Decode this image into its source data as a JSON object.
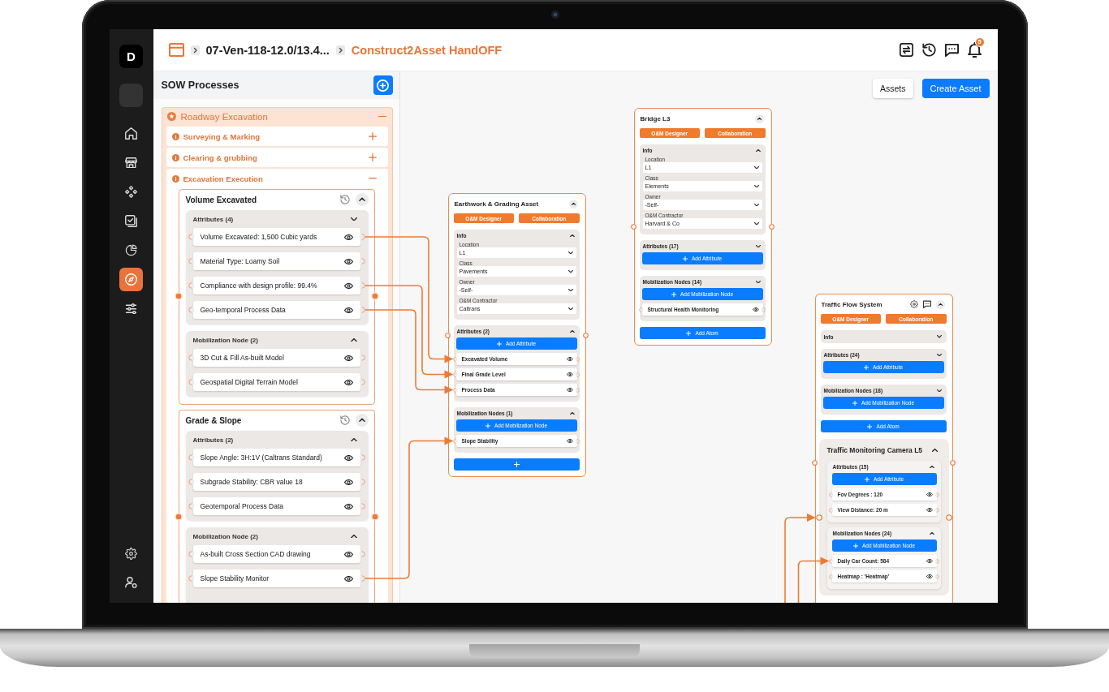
{
  "sidebar": {
    "logo": "D",
    "items": [
      {
        "selected": false
      },
      {
        "selected": false
      },
      {
        "selected": false
      },
      {
        "selected": false
      },
      {
        "selected": false
      },
      {
        "selected": true
      },
      {
        "selected": false
      }
    ],
    "footer_items": [
      {
        "selected": false
      },
      {
        "selected": false
      }
    ]
  },
  "top_bar": {
    "breadcrumb": [
      {
        "label": "07-Ven-118-12.0/13.4...",
        "current": false
      },
      {
        "label": "Construct2Asset HandOFF",
        "current": true
      }
    ],
    "notifications": "5"
  },
  "sow_panel": {
    "title": "SOW Processes",
    "processes": [
      {
        "label": "Roadway Excavation",
        "expanded": true,
        "steps": [
          {
            "label": "Surveying & Marking",
            "expanded": false
          },
          {
            "label": "Clearing & grubbing",
            "expanded": false
          },
          {
            "label": "Excavation Execution",
            "expanded": true,
            "cards": [
              {
                "title": "Volume Excavated",
                "expanded": true,
                "sections": [
                  {
                    "title": "Attributes (4)",
                    "expanded": false,
                    "items": [
                      {
                        "label": "Volume Excavated: 1,500 Cubic yards",
                        "connected": true
                      },
                      {
                        "label": "Material Type: Loamy Soil",
                        "connected": false
                      },
                      {
                        "label": "Compliance with design profile: 99.4%",
                        "connected": true
                      },
                      {
                        "label": "Geo-temporal Process Data",
                        "connected": true
                      }
                    ]
                  },
                  {
                    "title": "Mobilization Node (2)",
                    "expanded": true,
                    "items": [
                      {
                        "label": "3D Cut & Fill As-built Model",
                        "connected": false
                      },
                      {
                        "label": "Geospatial Digital Terrain Model",
                        "connected": false
                      }
                    ]
                  }
                ]
              },
              {
                "title": "Grade & Slope",
                "expanded": true,
                "sections": [
                  {
                    "title": "Attributes (2)",
                    "expanded": true,
                    "items": [
                      {
                        "label": "Slope Angle: 3H:1V (Caltrans Standard)",
                        "connected": false
                      },
                      {
                        "label": "Subgrade Stability: CBR value 18",
                        "connected": false
                      },
                      {
                        "label": "Geotemporal Process Data",
                        "connected": false
                      }
                    ]
                  },
                  {
                    "title": "Mobilization Node (2)",
                    "expanded": true,
                    "items": [
                      {
                        "label": "As-built Cross Section CAD drawing",
                        "connected": false
                      },
                      {
                        "label": "Slope Stability Monitor",
                        "connected": true
                      }
                    ]
                  }
                ]
              }
            ]
          }
        ]
      }
    ]
  },
  "canvas": {
    "toolbar": [
      {
        "label": "Assets",
        "kind": "secondary"
      },
      {
        "label": "Create Asset",
        "kind": "primary"
      }
    ],
    "assets": [
      {
        "title": "Earthwork & Grading Asset",
        "expanded": true,
        "header_tools": false,
        "connected": false,
        "roles": [
          "O&M Designer",
          "Collaboration"
        ],
        "info": {
          "title": "Info",
          "expanded": true,
          "fields": [
            {
              "label": "Location",
              "value": "L1"
            },
            {
              "label": "Class",
              "value": "Pavements"
            },
            {
              "label": "Owner",
              "value": "-Self-"
            },
            {
              "label": "O&M Contractor",
              "value": "Caltrans"
            }
          ]
        },
        "sections": [
          {
            "title": "Attributes (2)",
            "expanded": true,
            "add_label": "Add Attribute",
            "items": [
              {
                "label": "Excavated Volume",
                "connected": true
              },
              {
                "label": "Final Grade Level",
                "connected": true
              },
              {
                "label": "Process Data",
                "connected": true
              }
            ]
          },
          {
            "title": "Mobilization Nodes (1)",
            "expanded": true,
            "add_label": "Add Mobilization Node",
            "items": [
              {
                "label": "Slope Stability",
                "connected": true
              }
            ]
          }
        ],
        "footer": {
          "kind": "icon"
        }
      },
      {
        "title": "Bridge L3",
        "expanded": true,
        "header_tools": false,
        "connected": false,
        "roles": [
          "O&M Designer",
          "Collaboration"
        ],
        "info": {
          "title": "Info",
          "expanded": true,
          "fields": [
            {
              "label": "Location",
              "value": "L1"
            },
            {
              "label": "Class",
              "value": "Elements"
            },
            {
              "label": "Owner",
              "value": "-Self-"
            },
            {
              "label": "O&M Contractor",
              "value": "Harvard & Co"
            }
          ]
        },
        "sections": [
          {
            "title": "Attributes (17)",
            "expanded": false,
            "add_label": "Add Attribute"
          },
          {
            "title": "Mobilization Nodes (14)",
            "expanded": false,
            "add_label": "Add Mobilization Node",
            "items": [
              {
                "label": "Structural Health Monitoring",
                "connected": false
              }
            ]
          }
        ],
        "footer": {
          "kind": "text",
          "label": "Add Atom"
        }
      },
      {
        "title": "Traffic Flow System",
        "expanded": true,
        "header_tools": true,
        "connected": false,
        "roles": [
          "O&M Designer",
          "Collaboration"
        ],
        "info": {
          "title": "Info",
          "expanded": false
        },
        "sections": [
          {
            "title": "Attributes (24)",
            "expanded": false,
            "add_label": "Add Attribute"
          },
          {
            "title": "Mobilization Nodes (18)",
            "expanded": false,
            "add_label": "Add Mobilization Node"
          }
        ],
        "footer": {
          "kind": "text",
          "label": "Add Atom"
        },
        "sub_assets": [
          {
            "title": "Traffic Monitoring Camera L5",
            "expanded": true,
            "connected": true,
            "sections": [
              {
                "title": "Attributes (15)",
                "expanded": true,
                "add_label": "Add Attribute",
                "items": [
                  {
                    "label": "Fov Degrees : 120",
                    "connected": false
                  },
                  {
                    "label": "View Distance: 20 m",
                    "connected": false
                  }
                ]
              },
              {
                "title": "Mobilization Nodes (24)",
                "expanded": true,
                "add_label": "Add Mobilization Node",
                "items": [
                  {
                    "label": "Daily Car Count: 584",
                    "connected": true
                  },
                  {
                    "label": "Heatmap : 'Heatmap'",
                    "connected": false
                  }
                ]
              }
            ]
          }
        ]
      }
    ]
  }
}
